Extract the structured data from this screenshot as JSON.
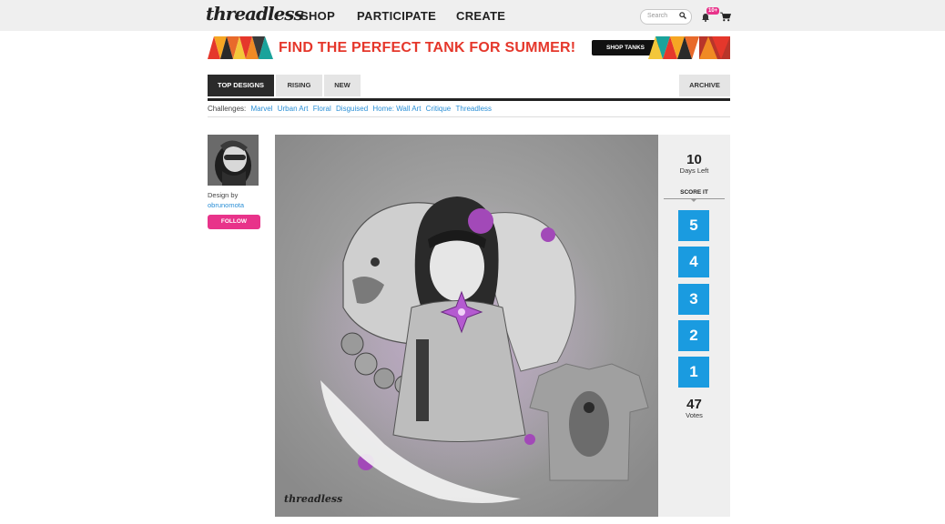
{
  "header": {
    "logo": "threadless",
    "nav": [
      "SHOP",
      "PARTICIPATE",
      "CREATE"
    ],
    "search_placeholder": "Search",
    "notification_badge": "10+"
  },
  "banner": {
    "headline": "FIND THE PERFECT TANK FOR SUMMER!",
    "cta": "SHOP TANKS"
  },
  "tabs": {
    "items": [
      "TOP DESIGNS",
      "RISING",
      "NEW"
    ],
    "archive": "ARCHIVE"
  },
  "challenges": {
    "label": "Challenges:",
    "items": [
      "Marvel",
      "Urban Art",
      "Floral",
      "Disguised",
      "Home: Wall Art",
      "Critique",
      "Threadless"
    ]
  },
  "designer": {
    "design_by": "Design by",
    "username": "obrunomota",
    "follow": "FOLLOW"
  },
  "artwork": {
    "watermark": "threadless"
  },
  "score": {
    "days_left_value": "10",
    "days_left_label": "Days Left",
    "score_label": "SCORE IT",
    "buttons": [
      "5",
      "4",
      "3",
      "2",
      "1"
    ],
    "votes_value": "47",
    "votes_label": "Votes"
  },
  "colors": {
    "accent_blue": "#1a9be0",
    "follow_pink": "#e8338a",
    "banner_red": "#e5372b",
    "link_blue": "#2a8fd6"
  },
  "icons": [
    "search-icon",
    "bell-icon",
    "cart-icon"
  ]
}
